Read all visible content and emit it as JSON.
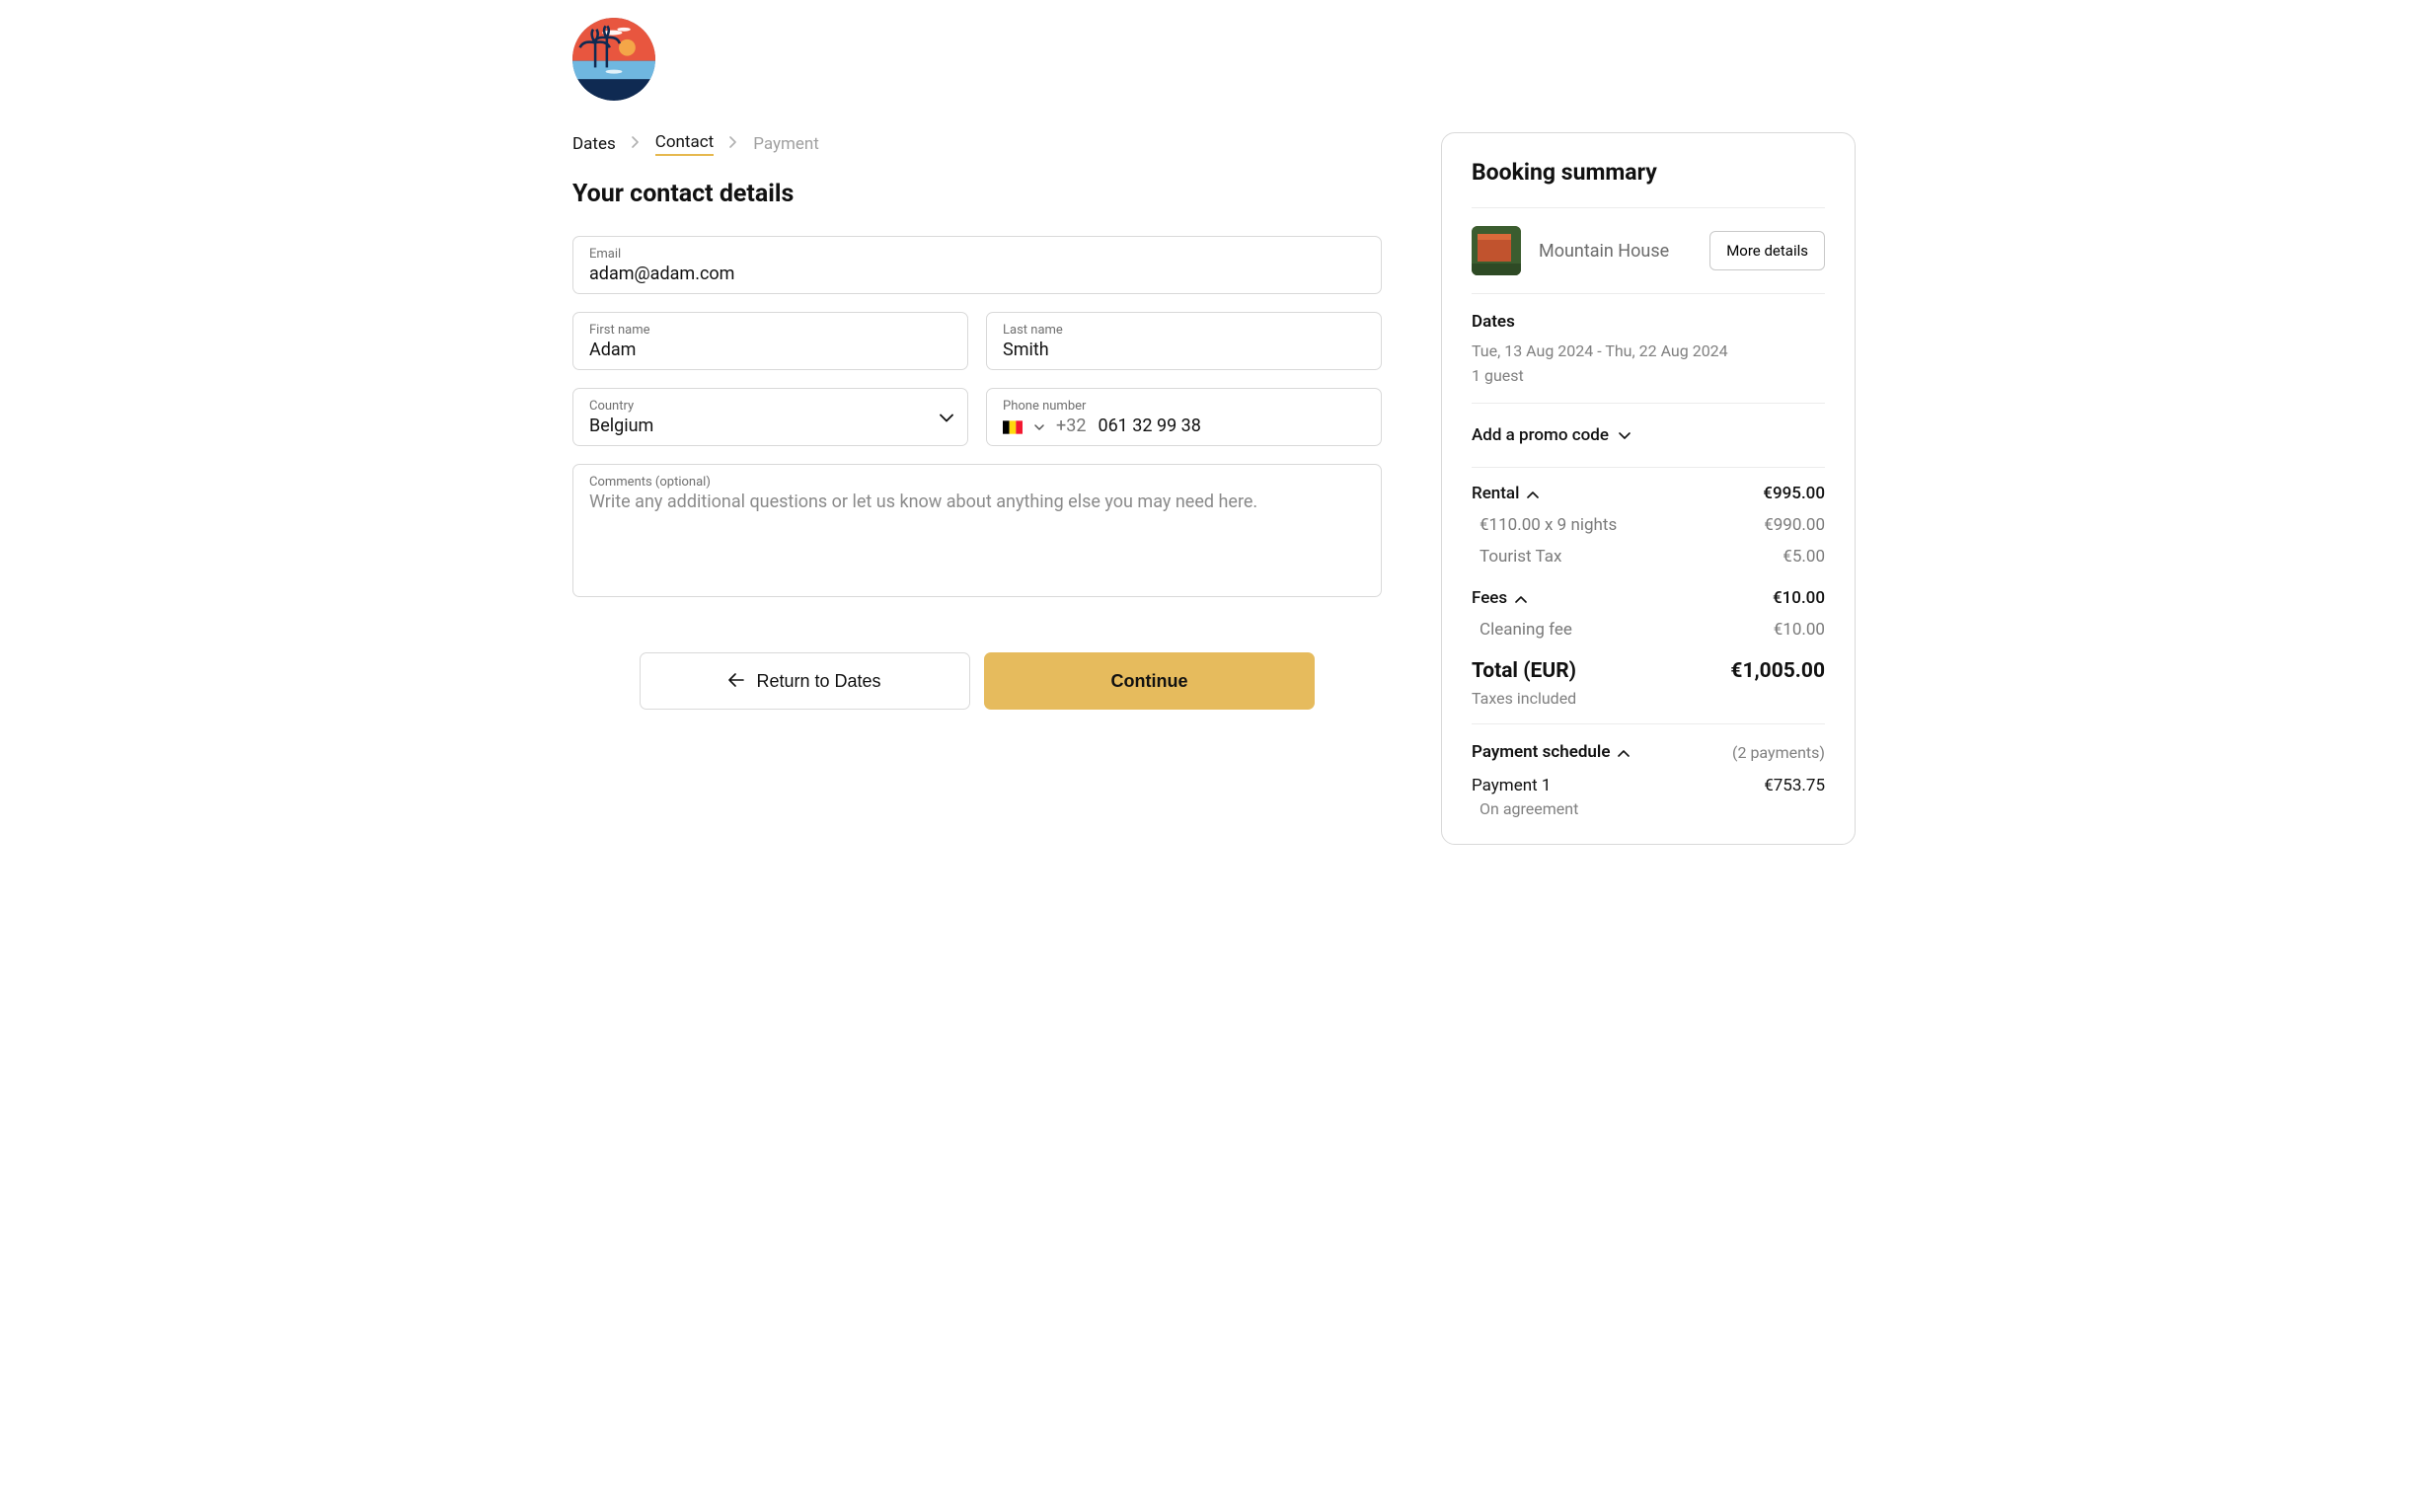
{
  "breadcrumb": {
    "items": [
      {
        "label": "Dates",
        "state": "done"
      },
      {
        "label": "Contact",
        "state": "active"
      },
      {
        "label": "Payment",
        "state": "disabled"
      }
    ]
  },
  "page": {
    "title": "Your contact details"
  },
  "form": {
    "email_label": "Email",
    "email_value": "adam@adam.com",
    "first_name_label": "First name",
    "first_name_value": "Adam",
    "last_name_label": "Last name",
    "last_name_value": "Smith",
    "country_label": "Country",
    "country_value": "Belgium",
    "phone_label": "Phone number",
    "phone_prefix": "+32",
    "phone_value": "061 32 99 38",
    "comments_label": "Comments (optional)",
    "comments_placeholder": "Write any additional questions or let us know about anything else you may need here."
  },
  "actions": {
    "back_label": "Return to Dates",
    "continue_label": "Continue"
  },
  "summary": {
    "title": "Booking summary",
    "property_name": "Mountain House",
    "more_details_label": "More details",
    "dates_label": "Dates",
    "dates_value": "Tue, 13 Aug 2024 - Thu, 22 Aug 2024",
    "guests_value": "1 guest",
    "promo_label": "Add a promo code",
    "rental": {
      "label": "Rental",
      "total": "€995.00",
      "line1_label": "€110.00 x 9 nights",
      "line1_value": "€990.00",
      "line2_label": "Tourist Tax",
      "line2_value": "€5.00"
    },
    "fees": {
      "label": "Fees",
      "total": "€10.00",
      "line1_label": "Cleaning fee",
      "line1_value": "€10.00"
    },
    "total_label": "Total (EUR)",
    "total_value": "€1,005.00",
    "tax_note": "Taxes included",
    "payment_schedule": {
      "label": "Payment schedule",
      "count_label": "(2 payments)",
      "p1_label": "Payment 1",
      "p1_value": "€753.75",
      "p1_note": "On agreement"
    }
  }
}
